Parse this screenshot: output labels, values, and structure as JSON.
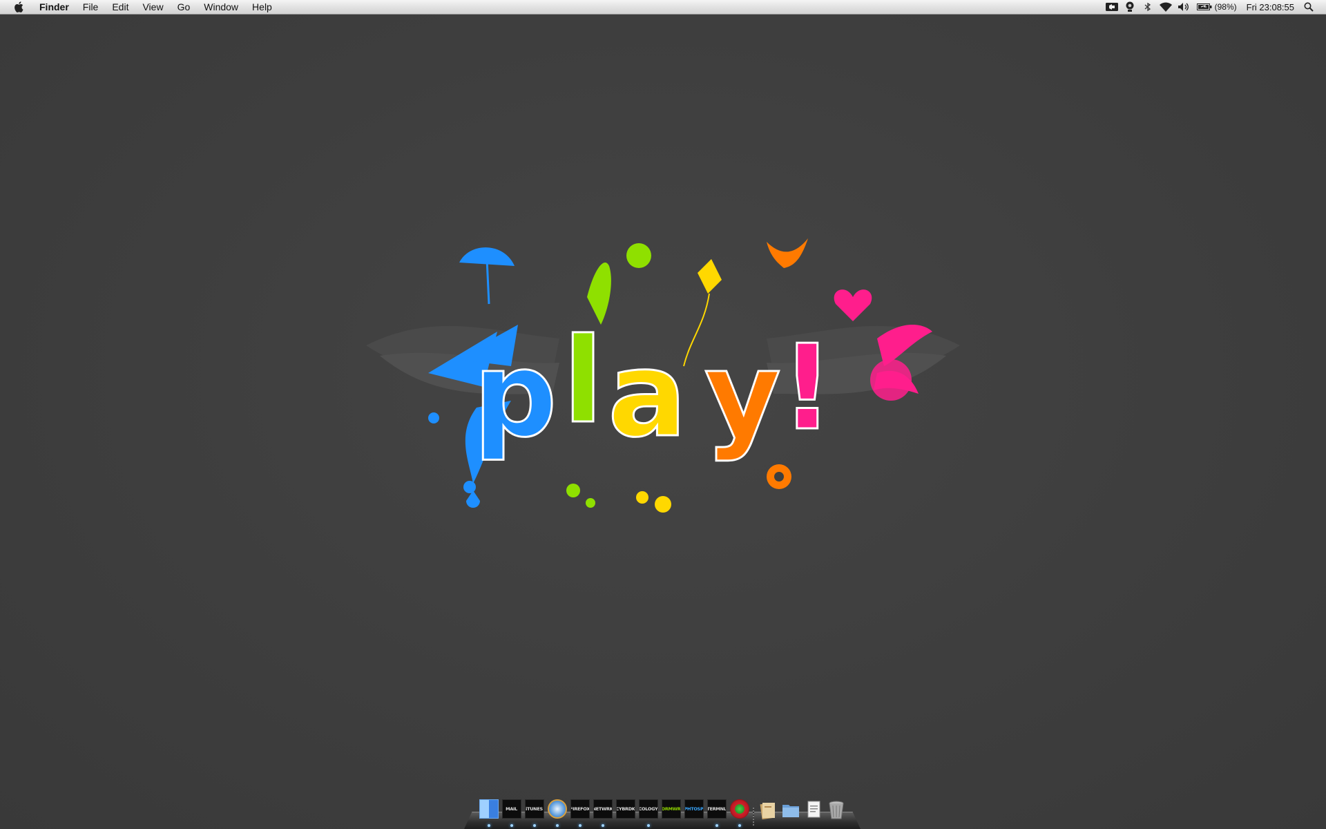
{
  "menubar": {
    "app_name": "Finder",
    "menus": [
      "File",
      "Edit",
      "View",
      "Go",
      "Window",
      "Help"
    ],
    "battery_percent": "(98%)",
    "clock": "Fri 23:08:55"
  },
  "wallpaper": {
    "title": "play!",
    "letters": [
      "p",
      "l",
      "a",
      "y",
      "!"
    ],
    "letter_colors": [
      "#1e8fff",
      "#8fe000",
      "#ffd800",
      "#ff7a00",
      "#ff1e8c"
    ]
  },
  "dock": {
    "items": [
      {
        "label": "",
        "icon": "finder-icon",
        "running": true
      },
      {
        "label": "MAIL",
        "icon": "mail-icon",
        "running": true
      },
      {
        "label": "iTUNES",
        "icon": "itunes-icon",
        "running": true
      },
      {
        "label": "",
        "icon": "safari-icon",
        "running": true
      },
      {
        "label": "FIREFOX",
        "icon": "firefox-icon",
        "running": true
      },
      {
        "label": "NETWRK",
        "icon": "network-icon",
        "running": true
      },
      {
        "label": "CYBRDK",
        "icon": "cyberduck-icon",
        "running": false
      },
      {
        "label": "COLOGY",
        "icon": "colloquy-icon",
        "running": true
      },
      {
        "label": "DRMWR",
        "icon": "dreamweaver-icon",
        "running": false
      },
      {
        "label": "PHTOSP",
        "icon": "photoshop-icon",
        "running": false
      },
      {
        "label": "TERMNL",
        "icon": "terminal-icon",
        "running": true
      },
      {
        "label": "",
        "icon": "app-star-icon",
        "running": true
      }
    ],
    "stacks": [
      {
        "icon": "documents-stack-icon"
      },
      {
        "icon": "folder-stack-icon"
      },
      {
        "icon": "document-icon"
      },
      {
        "icon": "trash-icon"
      }
    ],
    "colors": {
      "dryw": "#8fd400",
      "phtosp": "#3aa8ff",
      "default": "#dddddd"
    }
  }
}
